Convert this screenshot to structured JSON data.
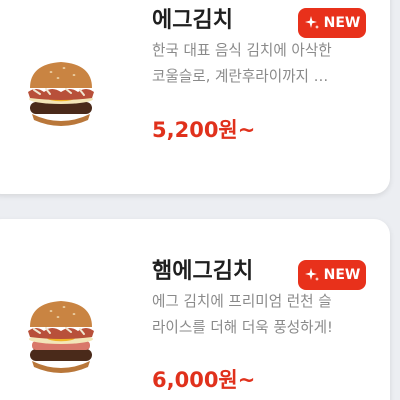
{
  "items": [
    {
      "name": "에그김치",
      "badge": "NEW",
      "desc_line1": "한국 대표 음식 김치에 아삭한",
      "desc_line2": "코울슬로, 계란후라이까지 …",
      "price": "5,200원~",
      "image_icon": "burger-image"
    },
    {
      "name": "햄에그김치",
      "badge": "NEW",
      "desc_line1": "에그 김치에 프리미엄 런천 슬",
      "desc_line2": "라이스를 더해 더욱 풍성하게!",
      "price": "6,000원~",
      "image_icon": "burger-image"
    }
  ],
  "colors": {
    "badge_bg": "#e8311b",
    "price": "#e0311c",
    "title": "#1f1f1f",
    "desc": "#8a8a8a",
    "background": "#eceef2",
    "card": "#ffffff"
  }
}
